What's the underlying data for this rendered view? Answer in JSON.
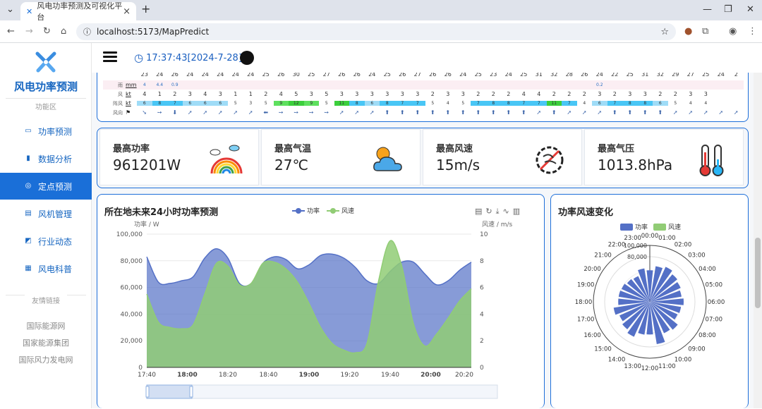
{
  "browser": {
    "tab_title": "风电功率预测及可视化平台",
    "url": "localhost:5173/MapPredict"
  },
  "sidebar": {
    "brand": "风电功率预测",
    "section_label": "功能区",
    "items": [
      {
        "label": "功率预测",
        "icon": "monitor-icon"
      },
      {
        "label": "数据分析",
        "icon": "bar-chart-icon"
      },
      {
        "label": "定点预测",
        "icon": "location-icon",
        "active": true
      },
      {
        "label": "风机管理",
        "icon": "document-icon"
      },
      {
        "label": "行业动态",
        "icon": "trend-icon"
      },
      {
        "label": "风电科普",
        "icon": "grid-icon"
      }
    ],
    "links_label": "友情链接",
    "links": [
      "国际能源网",
      "国家能源集团",
      "国际风力发电网"
    ]
  },
  "header": {
    "clock": "17:37:43[2024-7-28]"
  },
  "weather": {
    "temps": [
      "23",
      "24",
      "26",
      "24",
      "24",
      "24",
      "24",
      "24",
      "25",
      "26",
      "30",
      "25",
      "27",
      "26",
      "26",
      "24",
      "25",
      "26",
      "27",
      "26",
      "26",
      "24",
      "25",
      "23",
      "24",
      "25",
      "31",
      "32",
      "28",
      "26",
      "24",
      "22",
      "25",
      "31",
      "32",
      "29",
      "27",
      "25",
      "24",
      "2"
    ],
    "rain_label": "雨",
    "rain_unit": "mm",
    "rain": [
      "4",
      "4.4",
      "0.9",
      "",
      "",
      "",
      "",
      "",
      "",
      "",
      "",
      "",
      "",
      "",
      "",
      "",
      "",
      "",
      "",
      "",
      "",
      "",
      "",
      "",
      "",
      "",
      "",
      "",
      "",
      "",
      "0.2",
      "",
      "",
      "",
      "",
      "",
      "",
      "",
      "",
      ""
    ],
    "wind_label": "风",
    "wind_unit": "kt",
    "wind": [
      "4",
      "1",
      "2",
      "3",
      "4",
      "3",
      "1",
      "1",
      "2",
      "4",
      "5",
      "3",
      "5",
      "3",
      "3",
      "3",
      "3",
      "3",
      "3",
      "2",
      "3",
      "3",
      "2",
      "2",
      "2",
      "4",
      "4",
      "2",
      "2",
      "2",
      "3",
      "2",
      "3",
      "3",
      "2",
      "2",
      "3",
      "3",
      "",
      ""
    ],
    "gust_label": "阵风",
    "gust_unit": "kt",
    "gust": [
      "6",
      "8",
      "7",
      "6",
      "6",
      "6",
      "5",
      "3",
      "5",
      "9",
      "12",
      "9",
      "5",
      "11",
      "8",
      "6",
      "8",
      "7",
      "7",
      "5",
      "4",
      "5",
      "7",
      "8",
      "8",
      "7",
      "7",
      "11",
      "7",
      "4",
      "6",
      "7",
      "8",
      "8",
      "6",
      "5",
      "4",
      "4",
      "",
      ""
    ],
    "dir_label": "风向"
  },
  "stats": [
    {
      "label": "最高功率",
      "value": "961201W",
      "icon": "rainbow-icon"
    },
    {
      "label": "最高气温",
      "value": "27℃",
      "icon": "sun-cloud-icon"
    },
    {
      "label": "最高风速",
      "value": "15m/s",
      "icon": "no-wind-icon"
    },
    {
      "label": "最高气压",
      "value": "1013.8hPa",
      "icon": "thermometer-icon"
    }
  ],
  "colors": {
    "power": "#5470c6",
    "wind": "#91cc75",
    "accent": "#1e6fd9"
  },
  "chart_data": [
    {
      "type": "area",
      "title": "所在地未来24小时功率预测",
      "ylabel_left": "功率 / W",
      "ylabel_right": "风速 / m/s",
      "ylim_left": [
        0,
        100000
      ],
      "ylim_right": [
        0,
        10
      ],
      "yticks_left": [
        "0",
        "20,000",
        "40,000",
        "60,000",
        "80,000",
        "100,000"
      ],
      "yticks_right": [
        "0",
        "2",
        "4",
        "6",
        "8",
        "10"
      ],
      "xticks": [
        "17:40",
        "18:00",
        "18:20",
        "18:40",
        "19:00",
        "19:20",
        "19:40",
        "20:00",
        "20:20"
      ],
      "series": [
        {
          "name": "功率",
          "axis": "left",
          "x": [
            0,
            6,
            12,
            18,
            24,
            30,
            36,
            42,
            48,
            54,
            60,
            66,
            72,
            78,
            84,
            90,
            96,
            102,
            108,
            114,
            120,
            126,
            132,
            138,
            144,
            150,
            156,
            162,
            168
          ],
          "values": [
            83000,
            64000,
            63000,
            65000,
            68000,
            82000,
            89000,
            82000,
            63000,
            63000,
            78000,
            83000,
            81000,
            74000,
            77000,
            84000,
            85000,
            82000,
            75000,
            65000,
            63000,
            72000,
            79000,
            79000,
            70000,
            62000,
            65000,
            73000,
            79000
          ]
        },
        {
          "name": "风速",
          "axis": "right",
          "x": [
            0,
            6,
            12,
            18,
            24,
            30,
            36,
            42,
            48,
            54,
            60,
            66,
            72,
            78,
            84,
            90,
            96,
            102,
            108,
            114,
            120,
            126,
            132,
            138,
            144,
            150,
            156,
            162,
            168
          ],
          "values": [
            5.5,
            3.4,
            3.0,
            2.9,
            3.2,
            5.5,
            7.8,
            7.6,
            6.2,
            6.3,
            7.8,
            7.9,
            7.4,
            6.4,
            4.8,
            3.0,
            1.8,
            1.3,
            1.1,
            1.8,
            6.5,
            9.5,
            7.6,
            3.3,
            1.6,
            2.5,
            3.7,
            5.0,
            5.9
          ]
        }
      ]
    },
    {
      "type": "polar-bar",
      "title": "功率风速变化",
      "legend": [
        "功率",
        "风速"
      ],
      "categories": [
        "00:00",
        "01:00",
        "02:00",
        "03:00",
        "04:00",
        "05:00",
        "06:00",
        "07:00",
        "08:00",
        "09:00",
        "10:00",
        "11:00",
        "12:00",
        "13:00",
        "14:00",
        "15:00",
        "16:00",
        "17:00",
        "18:00",
        "19:00",
        "20:00",
        "21:00",
        "22:00",
        "23:00"
      ],
      "radial_ticks": [
        "80,000",
        "100,000"
      ],
      "series": [
        {
          "name": "功率",
          "values": [
            56000,
            64000,
            68000,
            63000,
            60000,
            57000,
            60000,
            56000,
            54000,
            64000,
            61000,
            76000,
            58000,
            59000,
            68000,
            63000,
            59000,
            65000,
            56000,
            56000,
            55000,
            52000,
            50000,
            60000
          ]
        }
      ]
    }
  ]
}
